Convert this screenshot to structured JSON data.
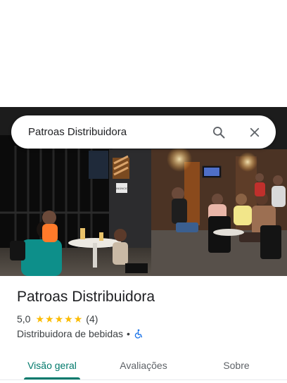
{
  "search": {
    "query": "Patroas Distribuidora"
  },
  "place": {
    "name": "Patroas Distribuidora",
    "rating": "5,0",
    "stars": 5,
    "review_count": "(4)",
    "category": "Distribuidora de bebidas",
    "separator": "•",
    "wheelchair_accessible": true
  },
  "tabs": [
    {
      "label": "Visão geral",
      "active": true
    },
    {
      "label": "Avaliações",
      "active": false
    },
    {
      "label": "Sobre",
      "active": false
    }
  ],
  "photo": {
    "sign_text": "ANÚNCIO"
  },
  "colors": {
    "accent": "#00796b",
    "star": "#fbbc04",
    "text": "#202124",
    "secondary": "#3c4043",
    "accessibility": "#1a73e8"
  },
  "icons": {
    "search": "search-icon",
    "close": "close-icon",
    "accessibility": "wheelchair-icon",
    "star": "star-icon"
  }
}
